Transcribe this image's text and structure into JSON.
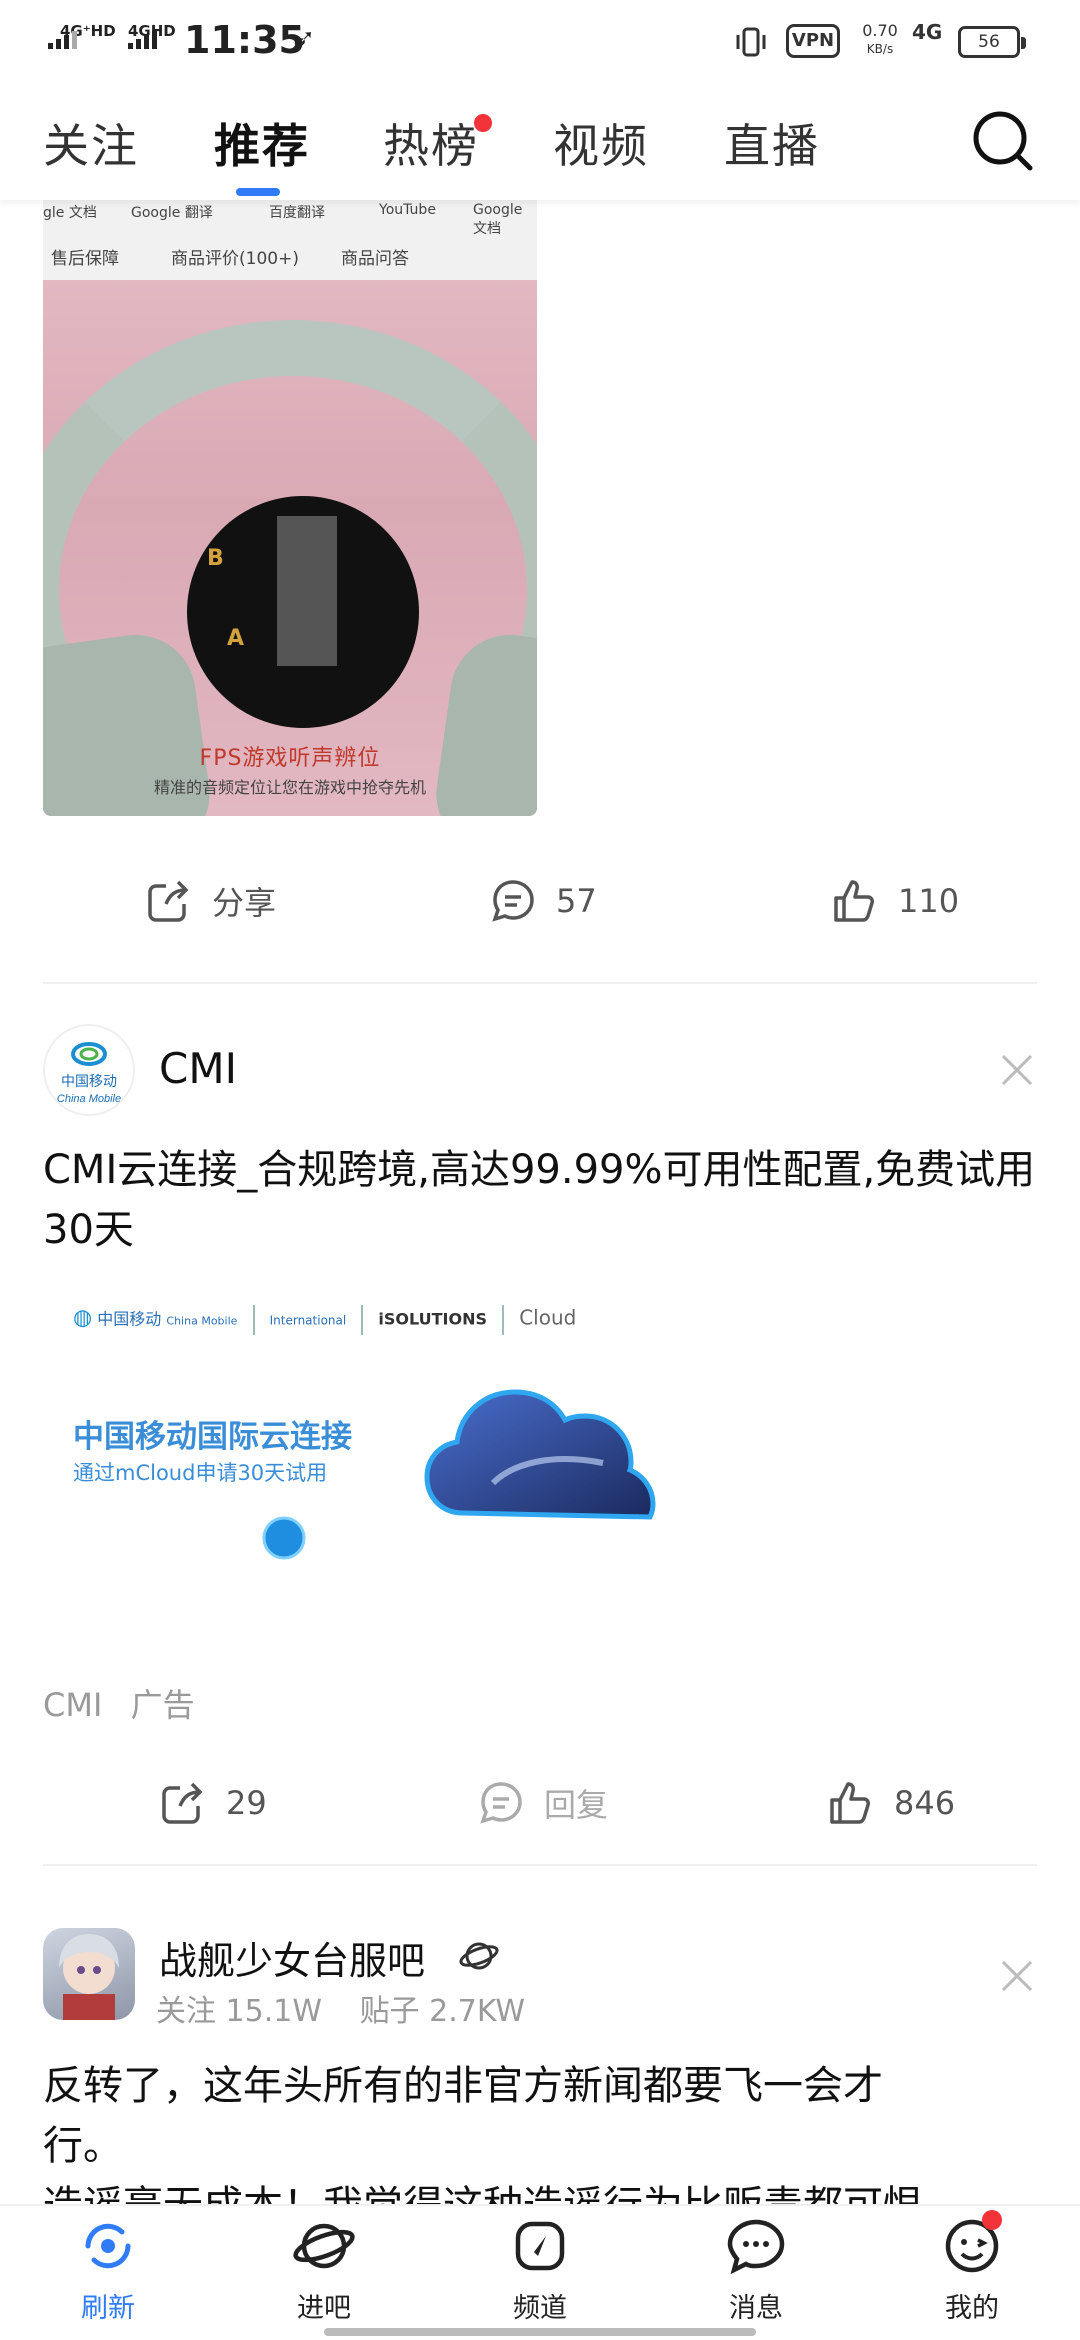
{
  "status_bar": {
    "sim1": "4G⁺HD",
    "sim2": "4GHD",
    "time": "11:35",
    "vpn": "VPN",
    "speed_value": "0.70",
    "speed_unit": "KB/s",
    "network": "4G",
    "battery": "56"
  },
  "tabs": [
    {
      "label": "关注",
      "active": false
    },
    {
      "label": "推荐",
      "active": true
    },
    {
      "label": "热榜",
      "active": false,
      "badge_dot": true
    },
    {
      "label": "视频",
      "active": false
    },
    {
      "label": "直播",
      "active": false
    }
  ],
  "post1": {
    "image": {
      "browser_bookmarks": [
        "gle 文档",
        "Google 翻译",
        "百度翻译",
        "YouTube",
        "Google 文档"
      ],
      "browser_tabs": [
        "售后保障",
        "商品评价(100+)",
        "商品问答"
      ],
      "radar_labels": [
        "B",
        "A"
      ],
      "caption": "FPS游戏听声辨位",
      "caption_sub": "精准的音频定位让您在游戏中抢夺先机"
    },
    "actions": {
      "share": "分享",
      "comments": "57",
      "likes": "110"
    }
  },
  "post2": {
    "author": "CMI",
    "avatar_text": [
      "中国移动",
      "China Mobile"
    ],
    "text": "CMI云连接_合规跨境,高达99.99%可用性配置,免费试用30天",
    "ad": {
      "brand": "中国移动",
      "brand_en": "China Mobile",
      "intl": "International",
      "solutions": "iSOLUTIONS",
      "cloud": "Cloud",
      "title": "中国移动国际云连接",
      "subtitle": "通过mCloud申请30天试用"
    },
    "meta": {
      "source": "CMI",
      "label": "广告"
    },
    "actions": {
      "shares": "29",
      "reply": "回复",
      "likes": "846"
    }
  },
  "post3": {
    "author": "战舰少女台服吧",
    "follow_label": "关注",
    "follow_count": "15.1W",
    "posts_label": "贴子",
    "posts_count": "2.7KW",
    "text_line1": "反转了，这年头所有的非官方新闻都要飞一会才",
    "text_line2": "行。",
    "text_line3": "造谣毫无成本！我觉得这种造谣行为比贩毒都可恨"
  },
  "bottom_nav": [
    {
      "label": "刷新",
      "icon": "refresh-icon",
      "active": true
    },
    {
      "label": "进吧",
      "icon": "planet-icon",
      "active": false
    },
    {
      "label": "频道",
      "icon": "compass-icon",
      "active": false
    },
    {
      "label": "消息",
      "icon": "message-icon",
      "active": false
    },
    {
      "label": "我的",
      "icon": "smiley-icon",
      "active": false,
      "badge_dot": true
    }
  ],
  "colors": {
    "accent": "#2f7cf6",
    "badge": "#f2333a",
    "muted": "#9a9a9a"
  }
}
